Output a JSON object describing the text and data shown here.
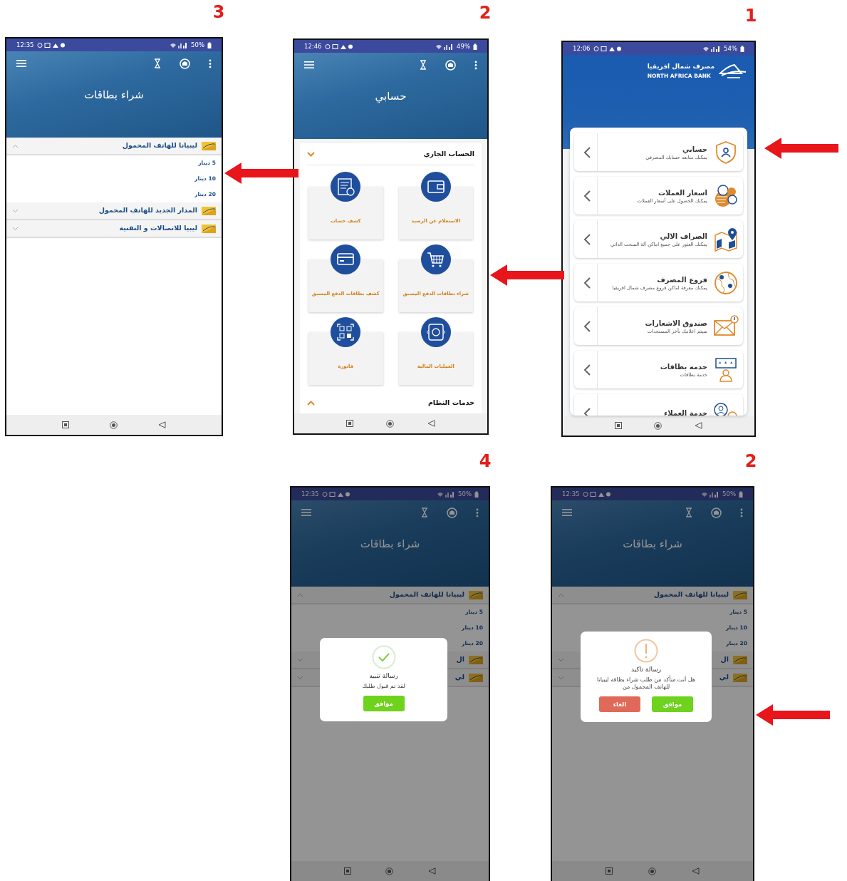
{
  "figure": [
    {
      "kind": "home",
      "step": "1",
      "arrow": true,
      "status": {
        "time": "12:06",
        "battery": "54%"
      },
      "bank_name_ar": "مصرف شمال افريقيا",
      "bank_name_en": "NORTH AFRICA BANK",
      "menu": [
        {
          "title": "حسابي",
          "subtitle": "يمكنك متابعه حسابك المصرفي"
        },
        {
          "title": "اسعار العملات",
          "subtitle": "يمكنك الحصول على أسعار العملات"
        },
        {
          "title": "الصراف الالي",
          "subtitle": "يمكنك العثور على جميع اماكن آلة السحب الذاتي"
        },
        {
          "title": "فروع المصرف",
          "subtitle": "يمكنك معرفة اماكن فروع مصرف شمال افريقيا"
        },
        {
          "title": "صندوق الاشعارات",
          "subtitle": "سيتم اعلامك بأخر المستجدات"
        },
        {
          "title": "خدمة بطاقات",
          "subtitle": "خدمة بطاقات"
        },
        {
          "title": "خدمة العملاء"
        }
      ]
    },
    {
      "kind": "account",
      "step": "2",
      "arrow": true,
      "status": {
        "time": "12:46",
        "battery": "49%"
      },
      "title": "حسابي",
      "section": {
        "title": "الحساب الجاري",
        "expanded": true
      },
      "tiles": [
        "الاستعلام عن الرصيد",
        "كشف حساب",
        "شراء بطاقات الدفع المسبق",
        "كشف بطاقات الدفع المسبق",
        "العمليات المالية",
        "فاتورة"
      ],
      "footer_section": {
        "title": "خدمات النظام",
        "expanded": false
      }
    },
    {
      "kind": "cards",
      "step": "3",
      "arrow": true,
      "status": {
        "time": "12:35",
        "battery": "50%"
      },
      "title": "شراء بطاقات",
      "groups": [
        {
          "name": "ليبيانا للهاتف المحمول",
          "expanded": true,
          "options": [
            "5 دينار",
            "10 دينار",
            "20 دينار"
          ]
        },
        {
          "name": "المدار الجديد للهاتف المحمول",
          "expanded": false
        },
        {
          "name": "ليبيا للاتصالات و التقنية",
          "expanded": false
        }
      ]
    },
    {
      "kind": "cards",
      "step": "2",
      "arrow": true,
      "status": {
        "time": "12:35",
        "battery": "50%"
      },
      "title": "شراء بطاقات",
      "groups": [
        {
          "name": "ليبيانا للهاتف المحمول",
          "expanded": true,
          "options": [
            "5 دينار",
            "10 دينار",
            "20 دينار"
          ]
        },
        {
          "name": "ال",
          "expanded": false
        },
        {
          "name": "لي",
          "expanded": false
        }
      ],
      "dialog": {
        "kind": "confirm",
        "title": "رسالة تاكيد",
        "message": "هل أنت متأكد من طلب شراء بطاقة ليبيانا للهاتف المحمول من",
        "buttons": [
          {
            "label": "موافق",
            "kind": "ok"
          },
          {
            "label": "الغاء",
            "kind": "cancel"
          }
        ]
      }
    },
    {
      "kind": "cards",
      "step": "4",
      "arrow": false,
      "status": {
        "time": "12:35",
        "battery": "50%"
      },
      "title": "شراء بطاقات",
      "groups": [
        {
          "name": "ليبيانا للهاتف المحمول",
          "expanded": true,
          "options": [
            "5 دينار",
            "10 دينار",
            "20 دينار"
          ]
        },
        {
          "name": "ال",
          "expanded": false
        },
        {
          "name": "لي",
          "expanded": false
        }
      ],
      "dialog": {
        "kind": "success",
        "title": "رسالة تنبيه",
        "message": "لقد تم قبول طلبك",
        "buttons": [
          {
            "label": "موافق",
            "kind": "ok"
          }
        ]
      }
    }
  ]
}
